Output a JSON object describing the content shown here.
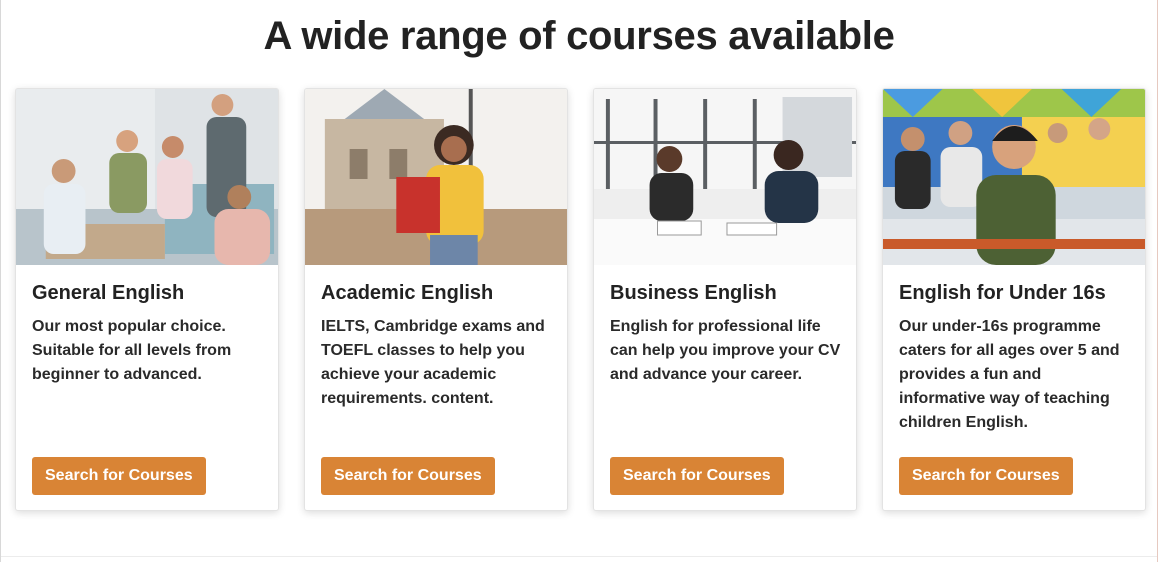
{
  "section": {
    "title": "A wide range of courses available"
  },
  "cards": [
    {
      "title": "General English",
      "text": "Our most popular choice. Suitable for all levels from beginner to advanced.",
      "button_label": "Search for Courses"
    },
    {
      "title": "Academic English",
      "text": "IELTS, Cambridge exams and TOEFL classes to help you achieve your academic requirements. content.",
      "button_label": "Search for Courses"
    },
    {
      "title": "Business English",
      "text": "English for professional life can help you improve your CV and advance your career.",
      "button_label": "Search for Courses"
    },
    {
      "title": "English for Under 16s",
      "text": "Our under-16s programme caters for all ages over 5 and provides a fun and informative way of teaching children English.",
      "button_label": "Search for Courses"
    }
  ],
  "colors": {
    "button": "#d98435",
    "button_text": "#ffffff",
    "title": "#222222"
  }
}
